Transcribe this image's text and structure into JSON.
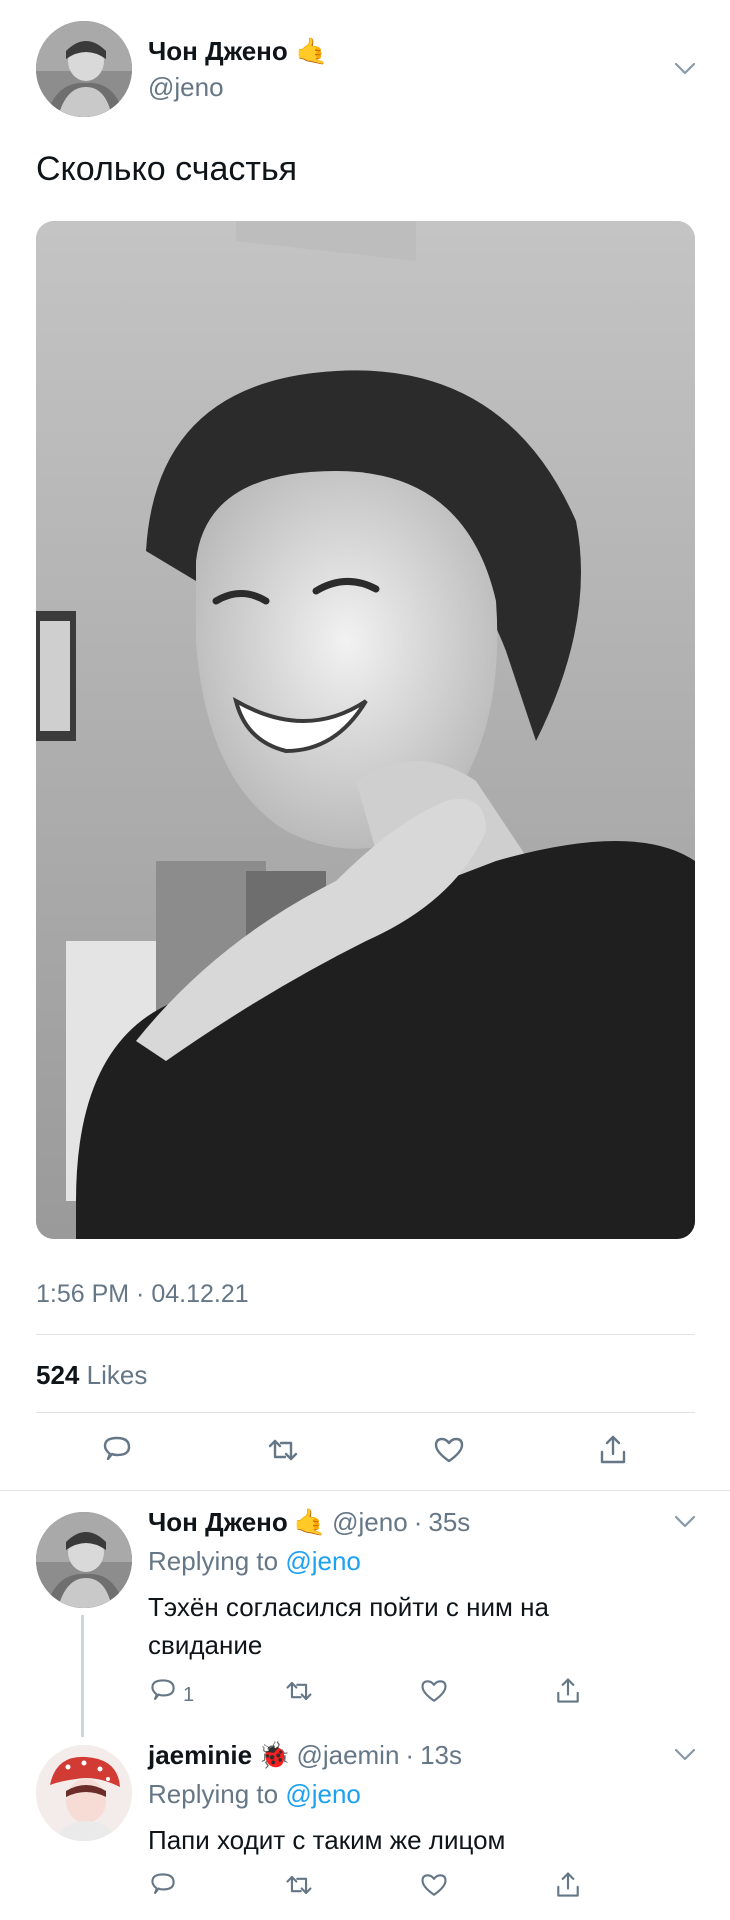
{
  "main_tweet": {
    "author_name": "Чон Джено",
    "author_emoji": "🤙",
    "author_handle": "@jeno",
    "text": "Сколько счастья",
    "timestamp": "1:56 PM · 04.12.21",
    "likes_count": "524",
    "likes_label": "Likes",
    "actions": [
      "reply-icon",
      "retweet-icon",
      "like-icon",
      "share-icon"
    ]
  },
  "replies": [
    {
      "author_name": "Чон Джено",
      "author_emoji": "🤙",
      "author_handle": "@jeno",
      "time": "35s",
      "replying_to_label": "Replying to",
      "replying_to_handle": "@jeno",
      "text": "Тэхён согласился пойти с ним на свидание",
      "reply_count": "1"
    },
    {
      "author_name": "jaeminie",
      "author_emoji": "🐞",
      "author_handle": "@jaemin",
      "time": "13s",
      "replying_to_label": "Replying to",
      "replying_to_handle": "@jeno",
      "text": "Папи ходит с таким же лицом",
      "reply_count": ""
    }
  ],
  "colors": {
    "text": "#0f1419",
    "secondary": "#657786",
    "link": "#1da1f2",
    "divider": "#dfe3e6",
    "thread_line": "#ccd6dd"
  }
}
